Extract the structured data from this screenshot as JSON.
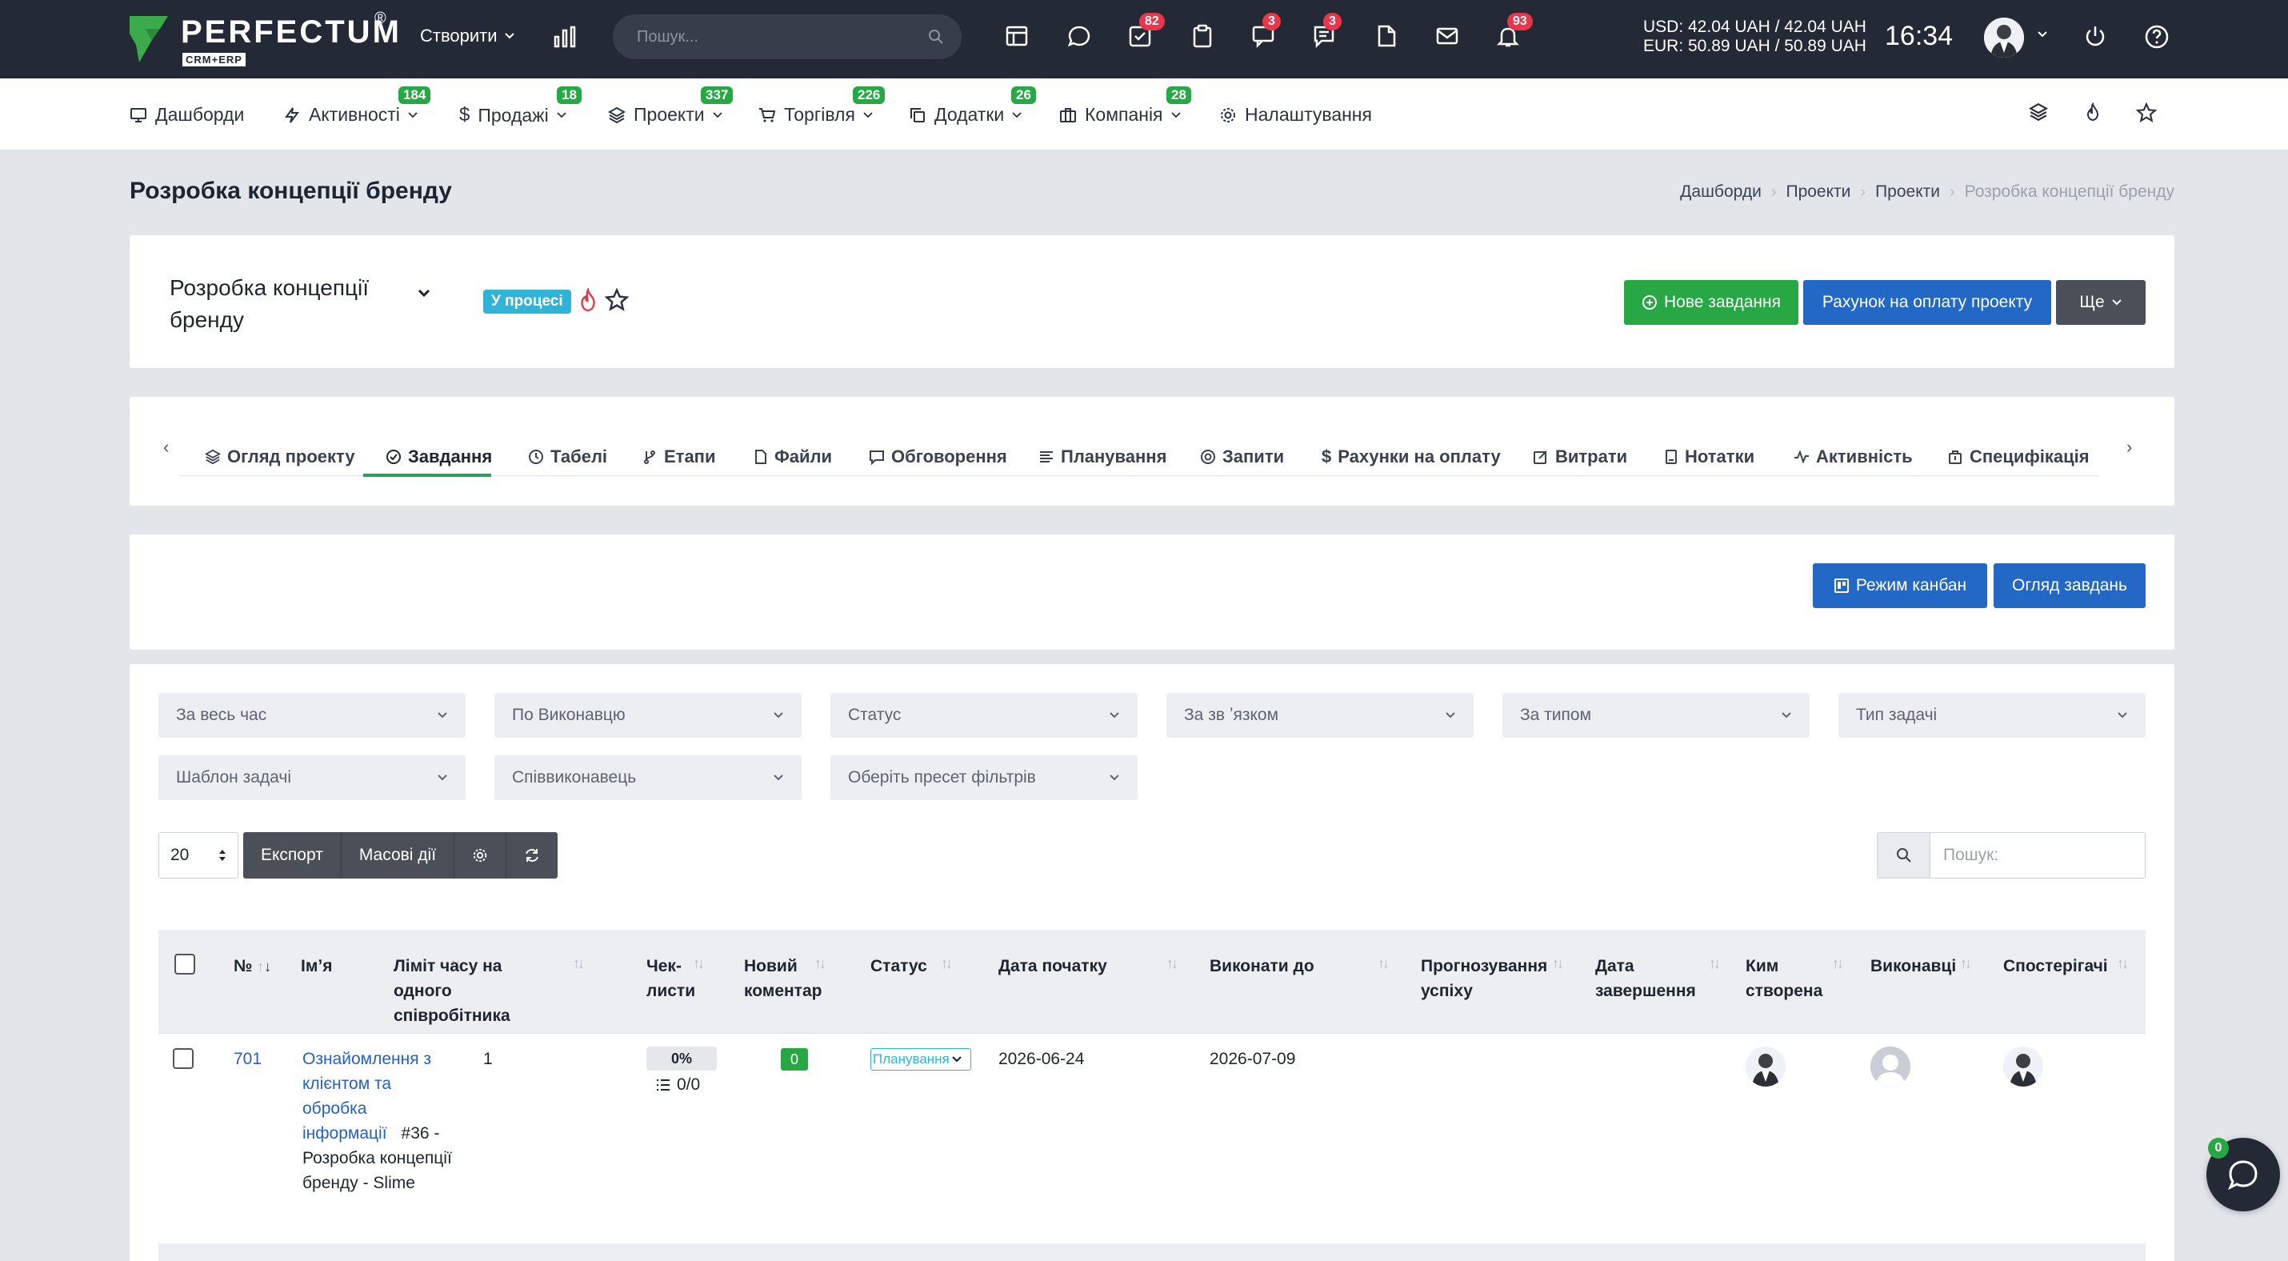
{
  "topbar": {
    "logo_text": "PERFECTUM",
    "logo_reg": "®",
    "logo_sub": "CRM+ERP",
    "create_label": "Створити",
    "search_placeholder": "Пошук...",
    "badges": {
      "tasks": "82",
      "chat": "3",
      "comments": "3",
      "notifications": "93"
    },
    "currency_usd": "USD: 42.04 UAH / 42.04 UAH",
    "currency_eur": "EUR: 50.89 UAH / 50.89 UAH",
    "time": "16:34"
  },
  "nav": {
    "items": [
      {
        "label": "Дашборди",
        "icon": "monitor-icon"
      },
      {
        "label": "Активності",
        "icon": "lightning-icon",
        "badge": "184"
      },
      {
        "label": "Продажі",
        "icon": "dollar-icon",
        "badge": "18"
      },
      {
        "label": "Проекти",
        "icon": "layers-icon",
        "badge": "337"
      },
      {
        "label": "Торгівля",
        "icon": "cart-icon",
        "badge": "226"
      },
      {
        "label": "Додатки",
        "icon": "copy-icon",
        "badge": "26"
      },
      {
        "label": "Компанія",
        "icon": "briefcase-icon",
        "badge": "28"
      },
      {
        "label": "Налаштування",
        "icon": "gear-icon"
      }
    ]
  },
  "page": {
    "title": "Розробка концепції бренду",
    "breadcrumb": [
      "Дашборди",
      "Проекти",
      "Проекти",
      "Розробка концепції бренду"
    ]
  },
  "project": {
    "name_line1": "Розробка концепції",
    "name_line2": "бренду",
    "status": "У процесі",
    "btn_new_task": "Нове завдання",
    "btn_invoice": "Рахунок на оплату проекту",
    "btn_more": "Ще"
  },
  "tabs": [
    "Огляд проекту",
    "Завдання",
    "Табелі",
    "Етапи",
    "Файли",
    "Обговорення",
    "Планування",
    "Запити",
    "Рахунки на оплату",
    "Витрати",
    "Нотатки",
    "Активність",
    "Специфікація"
  ],
  "actions": {
    "kanban": "Режим канбан",
    "overview": "Огляд завдань"
  },
  "filters": [
    "За весь час",
    "По Виконавцю",
    "Статус",
    "За зв ʼязком",
    "За типом",
    "Тип задачі",
    "Шаблон задачі",
    "Співвиконавець",
    "Оберіть пресет фільтрів"
  ],
  "table_tools": {
    "length": "20",
    "export": "Експорт",
    "bulk": "Масові дії",
    "search_placeholder": "Пошук:"
  },
  "table": {
    "headers": {
      "num": "№",
      "name": "Імʼя",
      "limit": [
        "Ліміт часу на",
        "одного",
        "співробітника"
      ],
      "checklists": [
        "Чек-",
        "листи"
      ],
      "new_comment": [
        "Новий",
        "коментар"
      ],
      "status": "Статус",
      "start": "Дата початку",
      "due": "Виконати до",
      "forecast": [
        "Прогнозування",
        "успіху"
      ],
      "finish": [
        "Дата",
        "завершення"
      ],
      "created_by": [
        "Ким",
        "створена"
      ],
      "assignees": "Виконавці",
      "observers": "Спостерігачі"
    },
    "rows": [
      {
        "num": "701",
        "name_link": [
          "Ознайомлення з",
          "клієнтом та",
          "обробка",
          "інформації"
        ],
        "name_ref": "#36 -",
        "name_rest": [
          "Розробка концепції",
          "бренду - Slime"
        ],
        "limit": "1",
        "checklist_pct": "0%",
        "checklist_count": "0/0",
        "new_comments": "0",
        "status": "Планування",
        "start": "2026-06-24",
        "due": "2026-07-09"
      }
    ]
  },
  "chat": {
    "badge": "0"
  }
}
